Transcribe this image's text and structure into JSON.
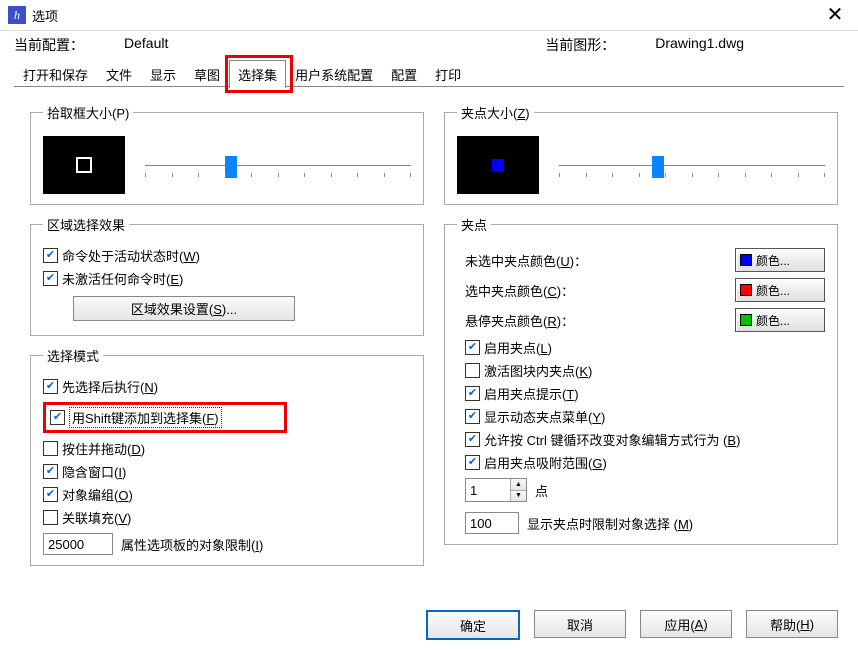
{
  "window": {
    "title": "选项",
    "close_icon": "close-icon"
  },
  "info": {
    "current_profile_label": "当前配置：",
    "current_profile_value": "Default",
    "current_drawing_label": "当前图形：",
    "current_drawing_value": "Drawing1.dwg"
  },
  "tabs": {
    "items": [
      "打开和保存",
      "文件",
      "显示",
      "草图",
      "选择集",
      "用户系统配置",
      "配置",
      "打印"
    ],
    "selected_index": 4
  },
  "left": {
    "pickbox": {
      "legend": "拾取框大小(P)"
    },
    "select_effect": {
      "legend": "区域选择效果",
      "active_cmd": {
        "checked": true,
        "label": "命令处于活动状态时(W)"
      },
      "no_cmd": {
        "checked": true,
        "label": "未激活任何命令时(E)"
      },
      "settings_btn": "区域效果设置(S)..."
    },
    "select_mode": {
      "legend": "选择模式",
      "noun_verb": {
        "checked": true,
        "label": "先选择后执行(N)"
      },
      "shift_add": {
        "checked": true,
        "label": "用Shift键添加到选择集(F)"
      },
      "press_drag": {
        "checked": false,
        "label": "按住并拖动(D)"
      },
      "implied_win": {
        "checked": true,
        "label": "隐含窗口(I)"
      },
      "obj_group": {
        "checked": true,
        "label": "对象编组(O)"
      },
      "assoc_hatch": {
        "checked": false,
        "label": "关联填充(V)"
      },
      "limit_value": "25000",
      "limit_label": "属性选项板的对象限制(I)"
    }
  },
  "right": {
    "gripsize": {
      "legend": "夹点大小(Z)"
    },
    "grips": {
      "legend": "夹点",
      "unsel_lbl": "未选中夹点颜色(U)：",
      "sel_lbl": "选中夹点颜色(C)：",
      "hover_lbl": "悬停夹点颜色(R)：",
      "color_btn_text": "颜色...",
      "unsel_color": "#0000ff",
      "sel_color": "#ff0000",
      "hover_color": "#00c000",
      "enable_grips": {
        "checked": true,
        "label": "启用夹点(L)"
      },
      "block_grips": {
        "checked": false,
        "label": "激活图块内夹点(K)"
      },
      "grip_tips": {
        "checked": true,
        "label": "启用夹点提示(T)"
      },
      "dyn_menu": {
        "checked": true,
        "label": "显示动态夹点菜单(Y)"
      },
      "ctrl_cycle": {
        "checked": true,
        "label": "允许按 Ctrl 键循环改变对象编辑方式行为 (B)"
      },
      "grip_snap": {
        "checked": true,
        "label": "启用夹点吸附范围(G)"
      },
      "spin_value": "1",
      "spin_label": "点",
      "grip_limit_value": "100",
      "grip_limit_label": "显示夹点时限制对象选择 (M)"
    }
  },
  "footer": {
    "ok": "确定",
    "cancel": "取消",
    "apply": "应用(A)",
    "help": "帮助(H)"
  }
}
